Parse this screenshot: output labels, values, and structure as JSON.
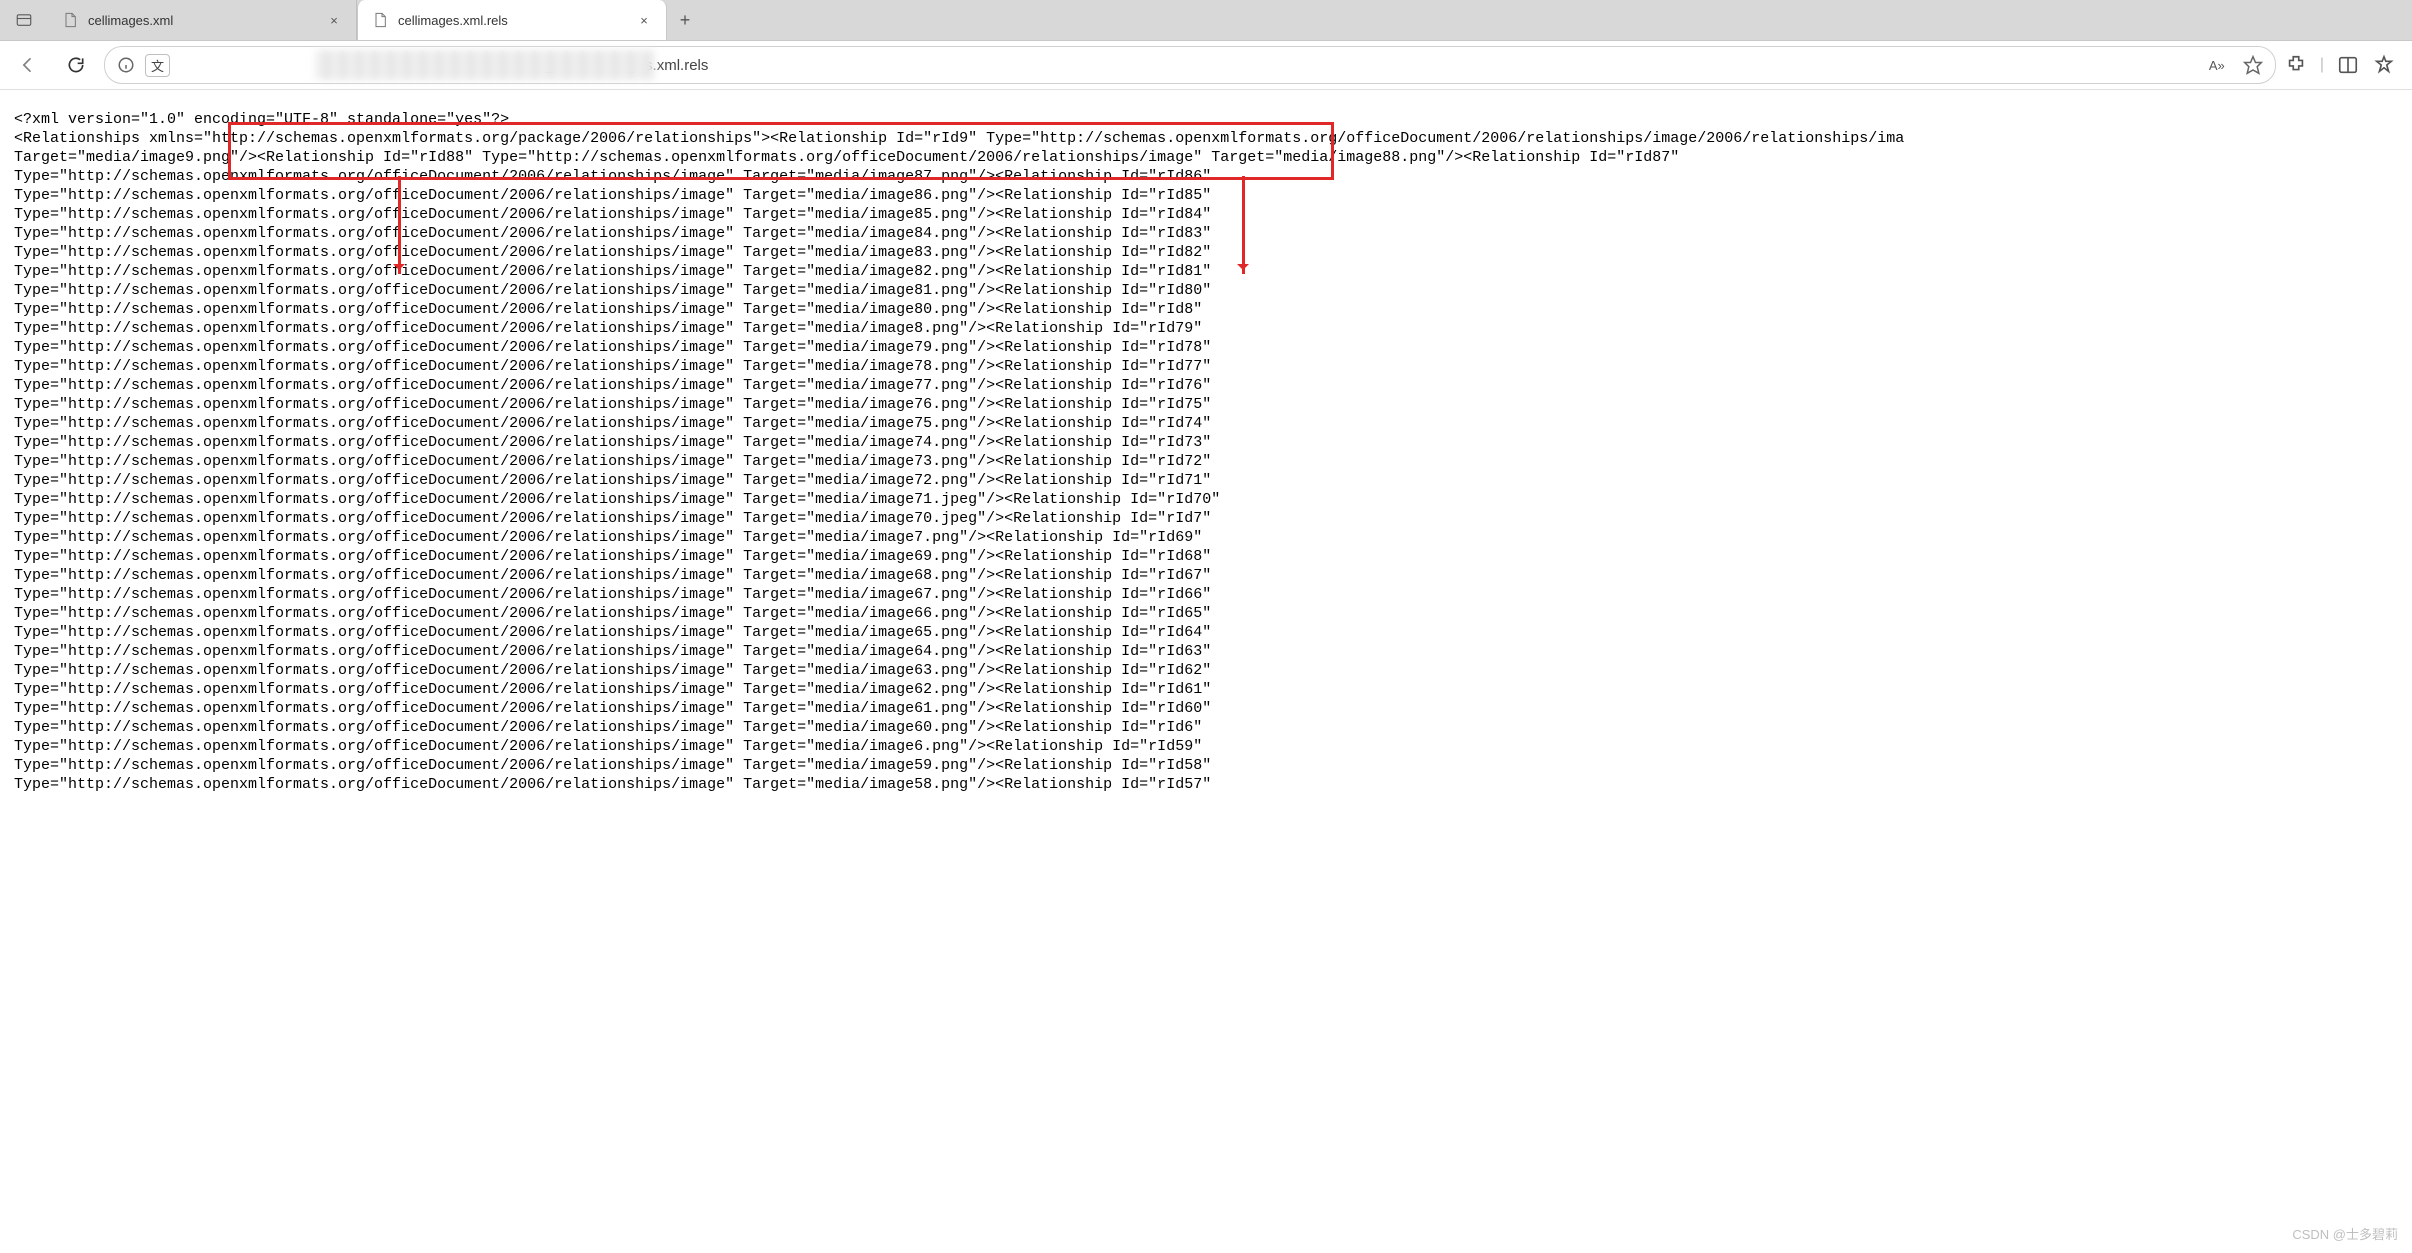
{
  "tabs": {
    "inactive": "cellimages.xml",
    "active": "cellimages.xml.rels"
  },
  "toolbar": {
    "tabs_icon": "tab-actions",
    "newtab": "+",
    "close": "×",
    "lang_label": "文"
  },
  "addressbar": {
    "visible_path": "xl/_rels/cellimages.xml.rels",
    "read_aloud": "A»",
    "favorite": "star-icon",
    "extensions": "puzzle-icon",
    "split": "split-screen-icon"
  },
  "xml": {
    "declaration": "<?xml version=\"1.0\" encoding=\"UTF-8\" standalone=\"yes\"?>",
    "root_open": "<Relationships xmlns=\"http://schemas.openxmlformats.org/package/2006/relationships\">",
    "rel_type": "http://schemas.openxmlformats.org/officeDocument/2006/relationships/image",
    "first_rel": {
      "id": "rId9",
      "target": "media/image9.png"
    },
    "highlighted_rel": {
      "id": "rId88",
      "target": "media/image88.png"
    },
    "trailing_after_highlight": {
      "id": "rId87"
    },
    "rows": [
      {
        "target": "media/image87.png",
        "next_id": "rId86"
      },
      {
        "target": "media/image86.png",
        "next_id": "rId85"
      },
      {
        "target": "media/image85.png",
        "next_id": "rId84"
      },
      {
        "target": "media/image84.png",
        "next_id": "rId83"
      },
      {
        "target": "media/image83.png",
        "next_id": "rId82"
      },
      {
        "target": "media/image82.png",
        "next_id": "rId81"
      },
      {
        "target": "media/image81.png",
        "next_id": "rId80"
      },
      {
        "target": "media/image80.png",
        "next_id": "rId8"
      },
      {
        "target": "media/image8.png",
        "next_id": "rId79"
      },
      {
        "target": "media/image79.png",
        "next_id": "rId78"
      },
      {
        "target": "media/image78.png",
        "next_id": "rId77"
      },
      {
        "target": "media/image77.png",
        "next_id": "rId76"
      },
      {
        "target": "media/image76.png",
        "next_id": "rId75"
      },
      {
        "target": "media/image75.png",
        "next_id": "rId74"
      },
      {
        "target": "media/image74.png",
        "next_id": "rId73"
      },
      {
        "target": "media/image73.png",
        "next_id": "rId72"
      },
      {
        "target": "media/image72.png",
        "next_id": "rId71"
      },
      {
        "target": "media/image71.jpeg",
        "next_id": "rId70"
      },
      {
        "target": "media/image70.jpeg",
        "next_id": "rId7"
      },
      {
        "target": "media/image7.png",
        "next_id": "rId69"
      },
      {
        "target": "media/image69.png",
        "next_id": "rId68"
      },
      {
        "target": "media/image68.png",
        "next_id": "rId67"
      },
      {
        "target": "media/image67.png",
        "next_id": "rId66"
      },
      {
        "target": "media/image66.png",
        "next_id": "rId65"
      },
      {
        "target": "media/image65.png",
        "next_id": "rId64"
      },
      {
        "target": "media/image64.png",
        "next_id": "rId63"
      },
      {
        "target": "media/image63.png",
        "next_id": "rId62"
      },
      {
        "target": "media/image62.png",
        "next_id": "rId61"
      },
      {
        "target": "media/image61.png",
        "next_id": "rId60"
      },
      {
        "target": "media/image60.png",
        "next_id": "rId6"
      },
      {
        "target": "media/image6.png",
        "next_id": "rId59"
      },
      {
        "target": "media/image59.png",
        "next_id": "rId58"
      },
      {
        "target": "media/image58.png",
        "next_id": "rId57"
      }
    ]
  },
  "watermark": "CSDN @士多碧莉"
}
